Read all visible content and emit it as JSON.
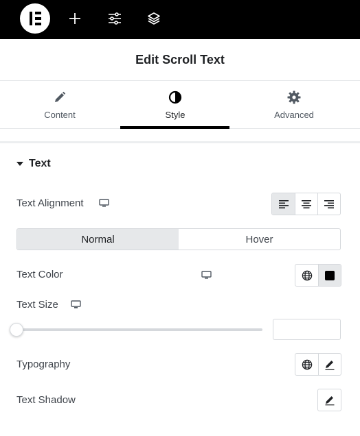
{
  "topbar": {
    "logo_icon": "elementor-logo-icon",
    "add_icon": "plus-icon",
    "settings_icon": "sliders-icon",
    "structure_icon": "layers-icon"
  },
  "panel": {
    "title": "Edit Scroll Text"
  },
  "tabs": [
    {
      "label": "Content",
      "icon": "pencil-icon",
      "active": false
    },
    {
      "label": "Style",
      "icon": "half-circle-icon",
      "active": true
    },
    {
      "label": "Advanced",
      "icon": "gear-icon",
      "active": false
    }
  ],
  "section": {
    "title": "Text",
    "expanded": true
  },
  "controls": {
    "text_alignment": {
      "label": "Text Alignment",
      "options": [
        "left",
        "center",
        "right"
      ],
      "selected": "left"
    },
    "state_toggle": {
      "options": [
        "Normal",
        "Hover"
      ],
      "selected": "Normal"
    },
    "text_color": {
      "label": "Text Color",
      "value": "#000000"
    },
    "text_size": {
      "label": "Text Size",
      "value": ""
    },
    "typography": {
      "label": "Typography"
    },
    "text_shadow": {
      "label": "Text Shadow"
    }
  },
  "colors": {
    "topbar_bg": "#000000",
    "active_tab_indicator": "#000000",
    "active_control_bg": "#e6e8ea"
  }
}
